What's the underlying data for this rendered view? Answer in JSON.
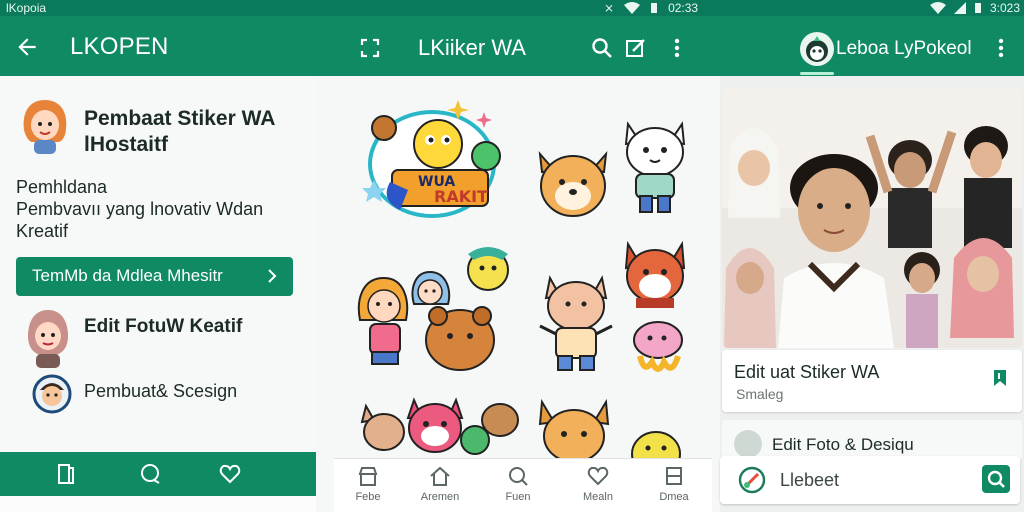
{
  "status_bar": {
    "left_text": "lKopoia",
    "right_mid_time": "02:33",
    "right_time": "3:023"
  },
  "app_bar": {
    "title_left": "LKOPEN",
    "title_mid": "LKiiker WA",
    "title_right": "Leboa LyPokeol",
    "accent": "#0f8a64"
  },
  "left_panel": {
    "hero_title": "Pembaat Stiker WA lHostaitf",
    "description_lines": [
      "Pemhldana",
      "Pembvavıı yang lnovativ Wdan",
      "Kreatif"
    ],
    "cta_label": "TemMb da Mdlea Mhesitr",
    "feature_1_title": "Edit FotuW Keatif",
    "feature_2_label": "Pembuat& Scesign"
  },
  "mid_nav": {
    "items": [
      {
        "label": "Febe",
        "icon": "store-icon"
      },
      {
        "label": "Aremen",
        "icon": "home-icon"
      },
      {
        "label": "Fuen",
        "icon": "search-icon"
      },
      {
        "label": "Mealn",
        "icon": "heart-icon"
      },
      {
        "label": "Dmea",
        "icon": "window-icon"
      }
    ]
  },
  "right_panel": {
    "card1_title": "Edit uat Stiker WA",
    "card1_subtitle": "Smaleg",
    "card2_title": "Edit Foto & Desiqu",
    "search_placeholder": "Llebeet"
  },
  "stickers": {
    "banner_text_1": "WUA",
    "banner_text_2": "RAKIT"
  }
}
